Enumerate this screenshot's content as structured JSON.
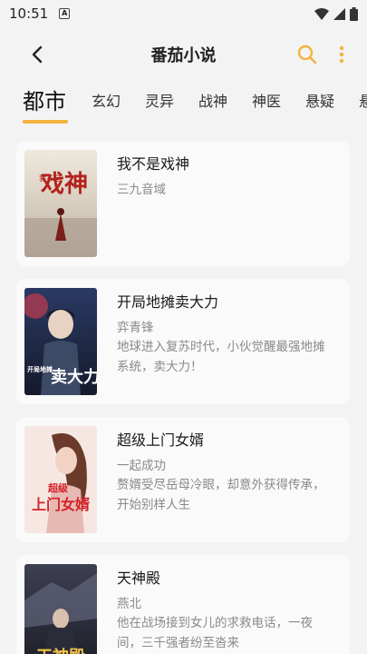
{
  "status_bar": {
    "time": "10:51",
    "notification": "A"
  },
  "app_bar": {
    "title": "番茄小说"
  },
  "tabs": [
    "都市",
    "玄幻",
    "灵异",
    "战神",
    "神医",
    "悬疑",
    "悬"
  ],
  "books": [
    {
      "title": "我不是戏神",
      "author": "三九音域",
      "desc": "",
      "cover_text": "戏神",
      "cover_small": "我不是"
    },
    {
      "title": "开局地摊卖大力",
      "author": "弈青锋",
      "desc": "地球进入复苏时代，小伙觉醒最强地摊系统，卖大力！",
      "cover_text": "卖大力",
      "cover_small": "开局地摊"
    },
    {
      "title": "超级上门女婿",
      "author": "一起成功",
      "desc": "赘婿受尽岳母冷眼，却意外获得传承，开始别样人生",
      "cover_text": "上门女婿",
      "cover_small": "超级"
    },
    {
      "title": "天神殿",
      "author": "燕北",
      "desc": "他在战场接到女儿的求救电话，一夜间，三千强者纷至沓来",
      "cover_text": "天神殿",
      "cover_small": ""
    }
  ],
  "colors": {
    "accent": "#f2b33d",
    "muted": "#8a8a8a"
  }
}
